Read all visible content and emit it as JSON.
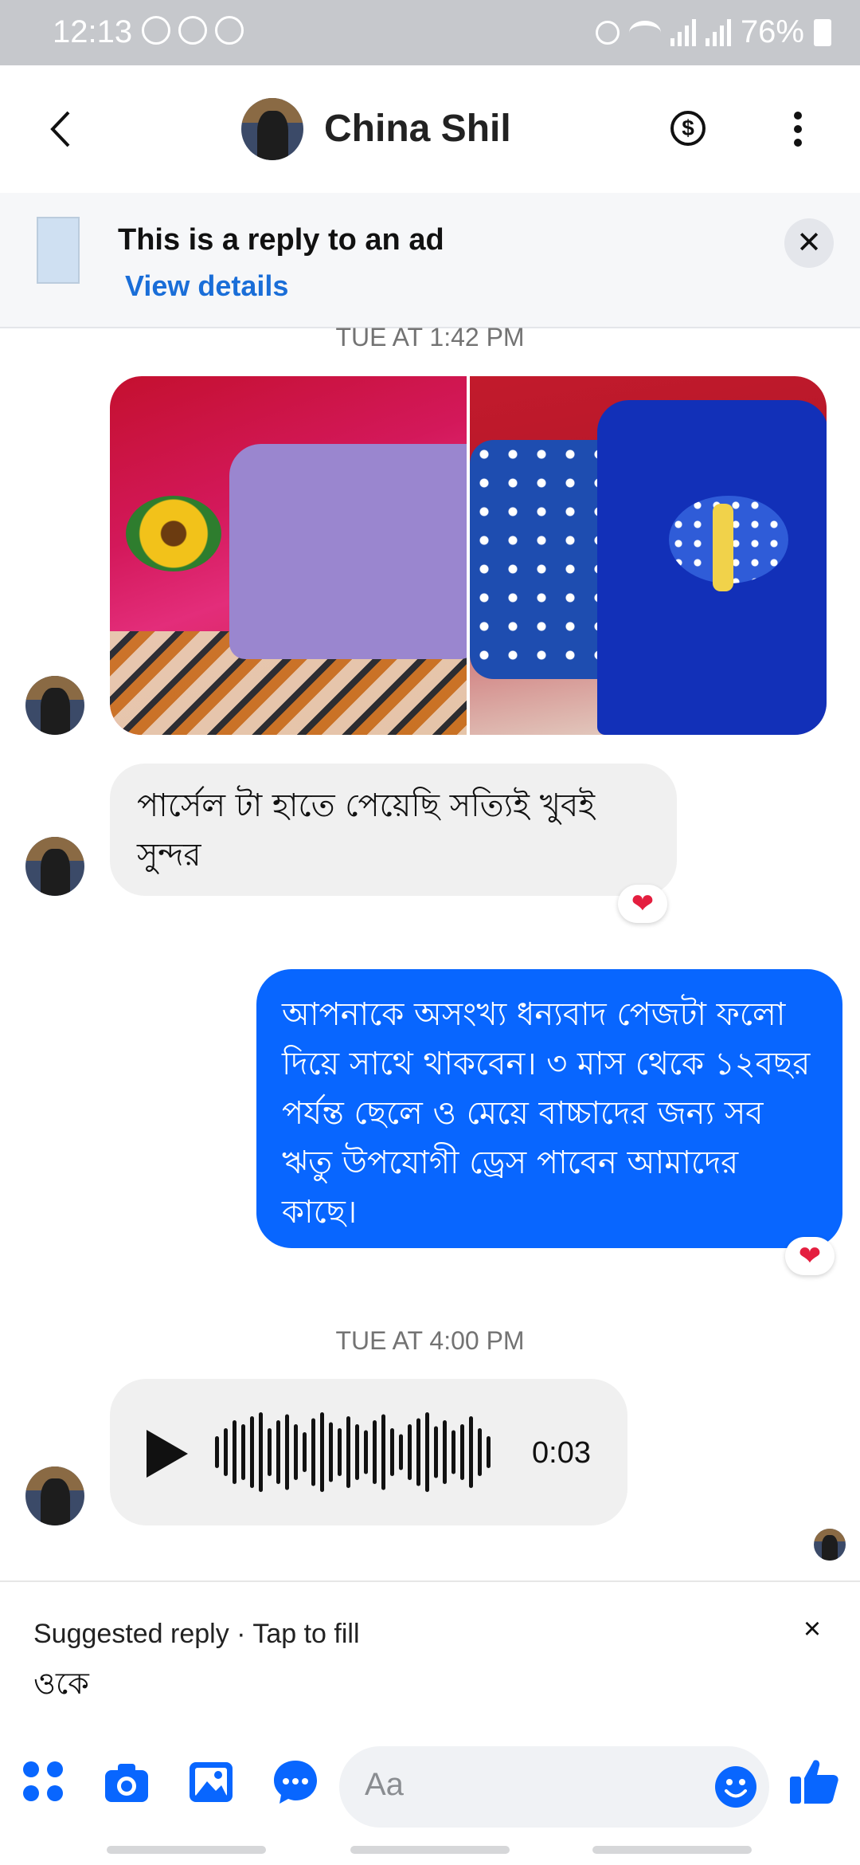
{
  "status_bar": {
    "time": "12:13",
    "battery": "76%"
  },
  "header": {
    "contact_name": "China Shil",
    "icons": [
      "back-icon",
      "dollar-icon",
      "more-icon"
    ]
  },
  "ad_banner": {
    "title": "This is a reply to an ad",
    "link": "View details"
  },
  "messages": {
    "timestamp_1": "TUE AT 1:42 PM",
    "incoming_text_1": "পার্সেল টা হাতে পেয়েছি  সত্যিই খুবই সুন্দর",
    "incoming_text_1_reaction": "❤",
    "outgoing_text_1": "আপনাকে অসংখ্য ধন্যবাদ পেজটা ফলো দিয়ে সাথে থাকবেন। ৩ মাস থেকে ১২বছর পর্যন্ত ছেলে ও মেয়ে বাচ্চাদের জন্য সব ঋতু উপযোগী ড্রেস পাবেন আমাদের কাছে।",
    "outgoing_text_1_reaction": "❤",
    "timestamp_2": "TUE AT 4:00 PM",
    "voice_duration": "0:03"
  },
  "suggested_reply": {
    "label": "Suggested reply · Tap to fill",
    "text": "ওকে",
    "close": "×"
  },
  "composer": {
    "placeholder": "Aa",
    "icons": [
      "apps-icon",
      "camera-icon",
      "gallery-icon",
      "chat-bubble-icon",
      "emoji-icon",
      "like-icon"
    ]
  },
  "colors": {
    "accent": "#0866ff",
    "incoming_bubble": "#f0f0f0",
    "status_bar_bg": "#c6c8cc",
    "reaction": "#e41e3f"
  }
}
